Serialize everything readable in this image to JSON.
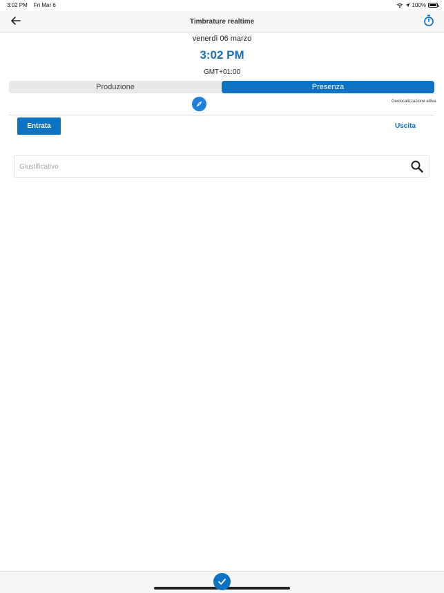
{
  "status_bar": {
    "time": "3:02 PM",
    "date": "Fri Mar 6",
    "battery": "100%"
  },
  "nav": {
    "title": "Timbrature realtime",
    "back_icon": "back-arrow-icon",
    "timer_icon": "stopwatch-icon"
  },
  "clock": {
    "date": "venerdì 06 marzo",
    "time": "3:02 PM",
    "timezone": "GMT+01:00"
  },
  "segments": [
    {
      "label": "Produzione",
      "selected": false
    },
    {
      "label": "Presenza",
      "selected": true
    }
  ],
  "geolocation": {
    "icon": "compass-icon",
    "label": "Geolocalizzazione attiva"
  },
  "actions": {
    "entrata_label": "Entrata",
    "uscita_label": "Uscita"
  },
  "search": {
    "placeholder": "Giustificativo",
    "value": ""
  },
  "colors": {
    "accent": "#0b72c4",
    "time_text": "#1a6fb5",
    "compass": "#1d7fd8"
  }
}
